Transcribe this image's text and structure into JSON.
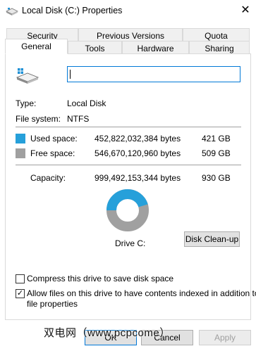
{
  "window": {
    "title": "Local Disk (C:) Properties",
    "close_glyph": "✕"
  },
  "tabs_row1": [
    "Security",
    "Previous Versions",
    "Quota"
  ],
  "tabs_row2": [
    "General",
    "Tools",
    "Hardware",
    "Sharing"
  ],
  "general": {
    "drive_name_value": "",
    "type_label": "Type:",
    "type_value": "Local Disk",
    "fs_label": "File system:",
    "fs_value": "NTFS",
    "used_label": "Used space:",
    "used_bytes": "452,822,032,384 bytes",
    "used_gb": "421 GB",
    "free_label": "Free space:",
    "free_bytes": "546,670,120,960 bytes",
    "free_gb": "509 GB",
    "capacity_label": "Capacity:",
    "capacity_bytes": "999,492,153,344 bytes",
    "capacity_gb": "930 GB",
    "used_fraction": 0.453,
    "drive_label": "Drive C:",
    "cleanup_label": "Disk Clean-up",
    "compress_label": "Compress this drive to save disk space",
    "compress_checked": false,
    "index_label_line1": "Allow files on this drive to have contents indexed in addition to",
    "index_label_line2": "file properties",
    "index_checked": true
  },
  "colors": {
    "used": "#26a0da",
    "free": "#a0a0a0",
    "accent": "#0078d7"
  },
  "footer": {
    "ok_label": "OK",
    "cancel_label": "Cancel",
    "apply_label": "Apply"
  },
  "watermark": "双电网（www.pcpcome）"
}
